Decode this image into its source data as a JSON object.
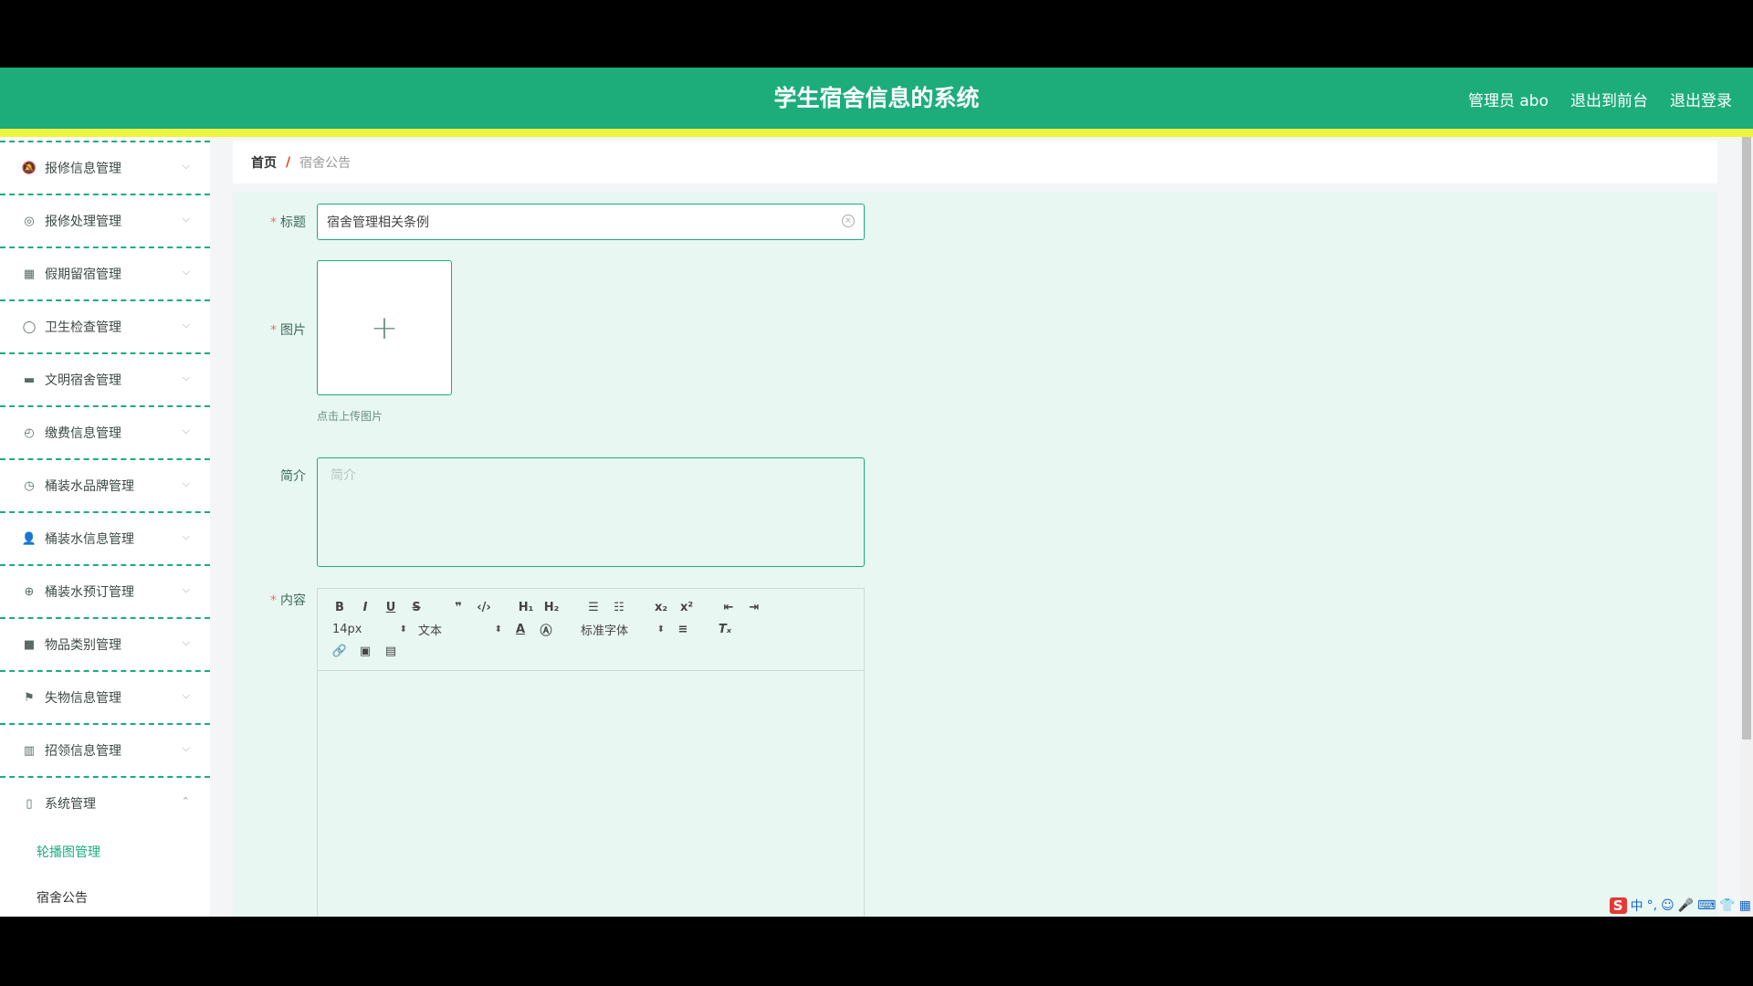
{
  "header": {
    "title": "学生宿舍信息的系统",
    "admin": "管理员 abo",
    "exit_front": "退出到前台",
    "logout": "退出登录"
  },
  "sidebar": {
    "items": [
      {
        "label": "报修信息管理",
        "icon": "bell-off-icon"
      },
      {
        "label": "报修处理管理",
        "icon": "compass-icon"
      },
      {
        "label": "假期留宿管理",
        "icon": "grid-icon"
      },
      {
        "label": "卫生检查管理",
        "icon": "circle-icon"
      },
      {
        "label": "文明宿舍管理",
        "icon": "chat-icon"
      },
      {
        "label": "缴费信息管理",
        "icon": "clock-icon"
      },
      {
        "label": "桶装水品牌管理",
        "icon": "gauge-icon"
      },
      {
        "label": "桶装水信息管理",
        "icon": "user-icon"
      },
      {
        "label": "桶装水预订管理",
        "icon": "crosshair-icon"
      },
      {
        "label": "物品类别管理",
        "icon": "video-icon"
      },
      {
        "label": "失物信息管理",
        "icon": "flag-icon"
      },
      {
        "label": "招领信息管理",
        "icon": "library-icon"
      },
      {
        "label": "系统管理",
        "icon": "mic-icon"
      }
    ],
    "sub_items": [
      "轮播图管理",
      "宿舍公告"
    ]
  },
  "breadcrumb": {
    "home": "首页",
    "sep": "/",
    "current": "宿舍公告"
  },
  "form": {
    "title_label": "标题",
    "title_value": "宿舍管理相关条例",
    "image_label": "图片",
    "upload_hint": "点击上传图片",
    "intro_label": "简介",
    "intro_placeholder": "简介",
    "content_label": "内容",
    "toolbar": {
      "font_size": "14px",
      "header": "文本",
      "font": "标准字体"
    }
  },
  "tray": {
    "ime": "中"
  },
  "colors": {
    "primary": "#1cad7b",
    "accent_bar": "#ecf43f",
    "panel": "#e8f7f1"
  }
}
